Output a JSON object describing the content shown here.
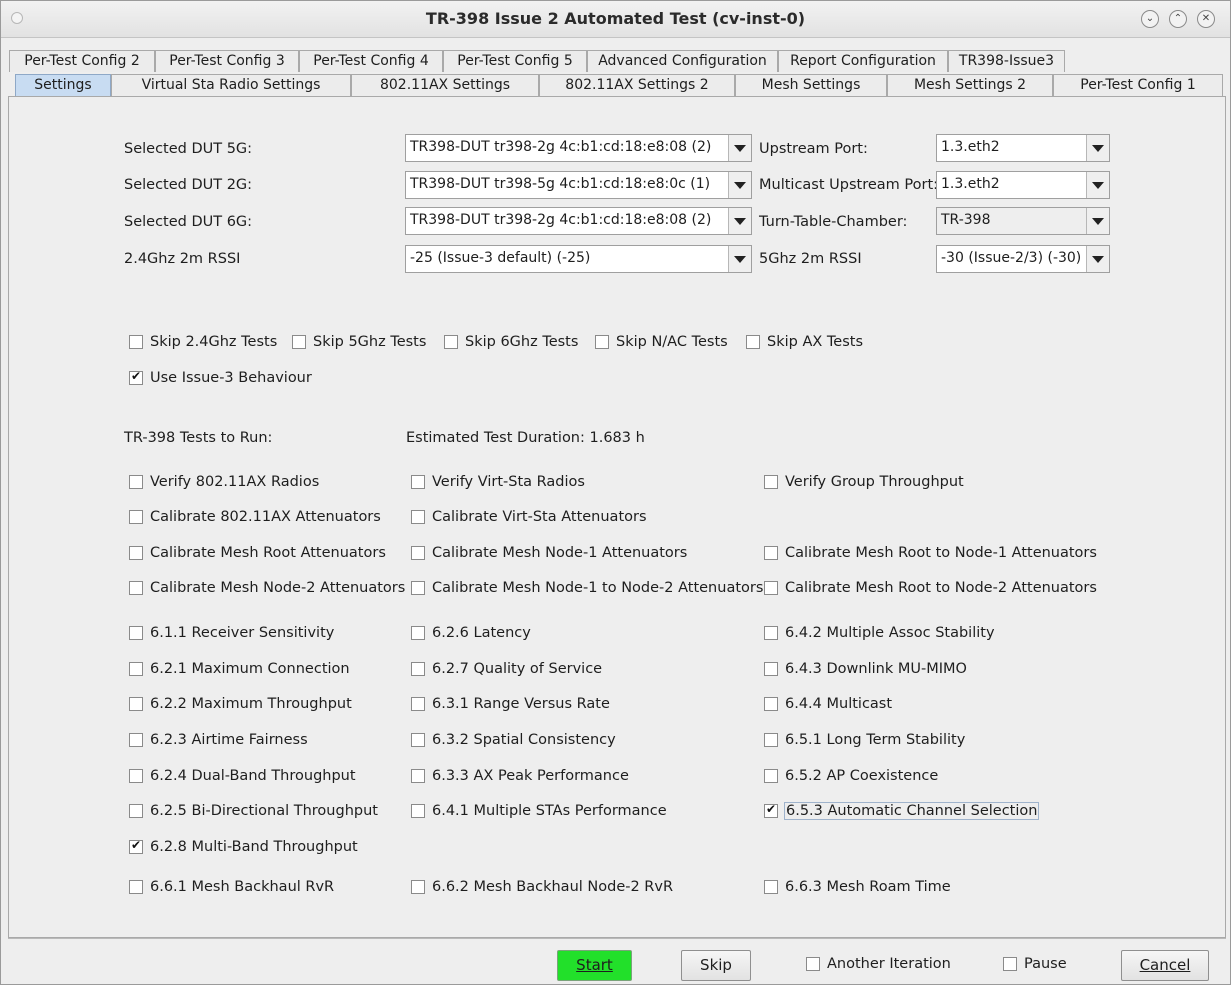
{
  "window": {
    "title": "TR-398 Issue 2 Automated Test  (cv-inst-0)"
  },
  "tabs_top": [
    "Per-Test Config 2",
    "Per-Test Config 3",
    "Per-Test Config 4",
    "Per-Test Config 5",
    "Advanced Configuration",
    "Report Configuration",
    "TR398-Issue3"
  ],
  "tabs_bottom": [
    "Settings",
    "Virtual Sta Radio Settings",
    "802.11AX Settings",
    "802.11AX Settings 2",
    "Mesh Settings",
    "Mesh Settings 2",
    "Per-Test Config 1"
  ],
  "active_tab": "Settings",
  "settings": {
    "dut5g_label": "Selected DUT 5G:",
    "dut5g_value": "TR398-DUT tr398-2g 4c:b1:cd:18:e8:08 (2)",
    "dut2g_label": "Selected DUT 2G:",
    "dut2g_value": "TR398-DUT tr398-5g 4c:b1:cd:18:e8:0c (1)",
    "dut6g_label": "Selected DUT 6G:",
    "dut6g_value": "TR398-DUT tr398-2g 4c:b1:cd:18:e8:08 (2)",
    "rssi24_label": "2.4Ghz 2m RSSI",
    "rssi24_value": "-25 (Issue-3 default) (-25)",
    "upstream_label": "Upstream Port:",
    "upstream_value": "1.3.eth2",
    "mc_upstream_label": "Multicast Upstream Port:",
    "mc_upstream_value": "1.3.eth2",
    "turntable_label": "Turn-Table-Chamber:",
    "turntable_value": "TR-398",
    "rssi5_label": "5Ghz 2m RSSI",
    "rssi5_value": "-30 (Issue-2/3) (-30)"
  },
  "skip_options": {
    "skip24": "Skip 2.4Ghz Tests",
    "skip5": "Skip 5Ghz Tests",
    "skip6": "Skip 6Ghz Tests",
    "skipnac": "Skip N/AC Tests",
    "skipax": "Skip AX Tests",
    "issue3": "Use Issue-3 Behaviour",
    "issue3_checked": true
  },
  "tests": {
    "heading": "TR-398 Tests to Run:",
    "duration": "Estimated Test Duration: 1.683 h",
    "t_verify_ax": "Verify 802.11AX Radios",
    "t_verify_virt": "Verify Virt-Sta Radios",
    "t_verify_group": "Verify Group Throughput",
    "t_cal_ax": "Calibrate 802.11AX Attenuators",
    "t_cal_virt": "Calibrate Virt-Sta Attenuators",
    "t_cal_root": "Calibrate Mesh Root Attenuators",
    "t_cal_node1": "Calibrate Mesh Node-1 Attenuators",
    "t_cal_root_node1": "Calibrate Mesh Root to Node-1 Attenuators",
    "t_cal_node2": "Calibrate Mesh Node-2 Attenuators",
    "t_cal_node1_node2": "Calibrate Mesh Node-1 to Node-2 Attenuators",
    "t_cal_root_node2": "Calibrate Mesh Root to Node-2 Attenuators",
    "t611": "6.1.1 Receiver Sensitivity",
    "t626": "6.2.6 Latency",
    "t642": "6.4.2 Multiple Assoc Stability",
    "t621": "6.2.1 Maximum Connection",
    "t627": "6.2.7 Quality of Service",
    "t643": "6.4.3 Downlink MU-MIMO",
    "t622": "6.2.2 Maximum Throughput",
    "t631": "6.3.1 Range Versus Rate",
    "t644": "6.4.4 Multicast",
    "t623": "6.2.3 Airtime Fairness",
    "t632": "6.3.2 Spatial Consistency",
    "t651": "6.5.1 Long Term Stability",
    "t624": "6.2.4 Dual-Band Throughput",
    "t633": "6.3.3 AX Peak Performance",
    "t652": "6.5.2 AP Coexistence",
    "t625": "6.2.5 Bi-Directional Throughput",
    "t641": "6.4.1 Multiple STAs Performance",
    "t653": "6.5.3 Automatic Channel Selection",
    "t653_checked": true,
    "t628": "6.2.8 Multi-Band Throughput",
    "t628_checked": true,
    "t661": "6.6.1 Mesh Backhaul RvR",
    "t662": "6.6.2 Mesh Backhaul Node-2 RvR",
    "t663": "6.6.3 Mesh Roam Time"
  },
  "footer": {
    "start": "Start",
    "skip": "Skip",
    "another_iteration": "Another Iteration",
    "pause": "Pause",
    "cancel": "Cancel"
  },
  "colors": {
    "start_button": "#22e02a",
    "active_tab": "#c8dcf2"
  }
}
